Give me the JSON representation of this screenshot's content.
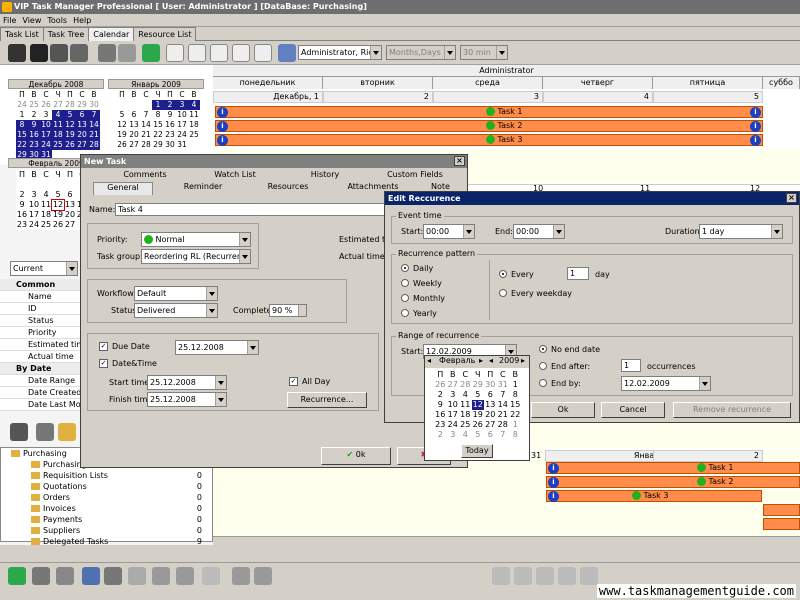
{
  "window": {
    "title": "VIP Task Manager Professional [ User: Administrator ] [DataBase: Purchasing]"
  },
  "menu": [
    "File",
    "View",
    "Tools",
    "Help"
  ],
  "view_tabs": [
    "Task List",
    "Task Tree",
    "Calendar",
    "Resource List"
  ],
  "toolbar": {
    "resource_combo": "Administrator, Rich M",
    "period_combo": "Months,Days",
    "interval_combo": "30 min"
  },
  "mini_calendar": {
    "month1": "Декабрь 2008",
    "month2": "Январь 2009",
    "month3": "Февраль 2009",
    "weekdays": [
      "П",
      "В",
      "С",
      "Ч",
      "П",
      "С",
      "В"
    ],
    "dec_days": [
      "24",
      "25",
      "26",
      "27",
      "28",
      "29",
      "30",
      "1",
      "2",
      "3",
      "4",
      "5",
      "6",
      "7",
      "8",
      "9",
      "10",
      "11",
      "12",
      "13",
      "14",
      "15",
      "16",
      "17",
      "18",
      "19",
      "20",
      "21",
      "22",
      "23",
      "24",
      "25",
      "26",
      "27",
      "28",
      "29",
      "30",
      "31"
    ],
    "jan_days": [
      "",
      "",
      "",
      "1",
      "2",
      "3",
      "4",
      "5",
      "6",
      "7",
      "8",
      "9",
      "10",
      "11",
      "12",
      "13",
      "14",
      "15",
      "16",
      "17",
      "18",
      "19",
      "20",
      "21",
      "22",
      "23",
      "24",
      "25",
      "26",
      "27",
      "28",
      "29",
      "30",
      "31"
    ],
    "feb_days": [
      "",
      "",
      "",
      "",
      "",
      "",
      "1",
      "2",
      "3",
      "4",
      "5",
      "6",
      "7",
      "8",
      "9",
      "10",
      "11",
      "12",
      "13",
      "14",
      "15",
      "16",
      "17",
      "18",
      "19",
      "20",
      "21",
      "22",
      "23",
      "24",
      "25",
      "26",
      "27"
    ]
  },
  "filter_combo": "Current",
  "properties": {
    "common_header": "Common",
    "common": [
      "Name",
      "ID",
      "Status",
      "Priority",
      "Estimated time",
      "Actual time"
    ],
    "bydate_header": "By Date",
    "bydate": [
      "Date Range",
      "Date Created",
      "Date Last Mod"
    ]
  },
  "tree": [
    {
      "label": "Purchasing",
      "count": ""
    },
    {
      "label": "Purchasing",
      "count": "0"
    },
    {
      "label": "Requisition Lists",
      "count": "0"
    },
    {
      "label": "Quotations",
      "count": "0"
    },
    {
      "label": "Orders",
      "count": "0"
    },
    {
      "label": "Invoices",
      "count": "0"
    },
    {
      "label": "Payments",
      "count": "0"
    },
    {
      "label": "Suppliers",
      "count": "0"
    },
    {
      "label": "Delegated Tasks",
      "count": "9"
    }
  ],
  "scheduler": {
    "resource": "Administrator",
    "days": [
      "понедельник",
      "вторник",
      "среда",
      "четверг",
      "пятница",
      "суббо"
    ],
    "week1_dates": [
      "Декабрь, 1",
      "2",
      "3",
      "4",
      "5"
    ],
    "week2_dates": [
      "10",
      "11",
      "12"
    ],
    "week3_dates": [
      "31",
      "Январь, 1",
      "2"
    ],
    "tasks_top": [
      "Task 1",
      "Task 2",
      "Task 3"
    ],
    "tasks_bottom": [
      "Task 1",
      "Task 2",
      "Task 3"
    ]
  },
  "new_task": {
    "title": "New Task",
    "tabs_row1": [
      "Comments",
      "Watch List",
      "History",
      "Custom Fields"
    ],
    "tabs_row2": [
      "General",
      "Reminder",
      "Resources",
      "Attachments",
      "Note"
    ],
    "name_label": "Name:",
    "name_value": "Task 4",
    "priority_label": "Priority:",
    "priority_value": "Normal",
    "group_label": "Task group:",
    "group_value": "Reordering RL (Recurrent tas",
    "est_label": "Estimated time",
    "act_label": "Actual time:",
    "workflow_label": "Workflow:",
    "workflow_value": "Default",
    "status_label": "Status:",
    "status_value": "Delivered",
    "complete_label": "Complete:",
    "complete_value": "90 %",
    "duedate_label": "Due Date",
    "duedate_value": "25.12.2008",
    "datetime_label": "Date&Time",
    "start_label": "Start time:",
    "start_value": "25.12.2008",
    "finish_label": "Finish time:",
    "finish_value": "25.12.2008",
    "allday_label": "All Day",
    "recurrence_button": "Recurrence...",
    "ok_button": "0k"
  },
  "recurrence": {
    "title": "Edit Reccurence",
    "event_time": "Event time",
    "start_label": "Start:",
    "start_value": "00:00",
    "end_label": "End:",
    "end_value": "00:00",
    "duration_label": "Duration:",
    "duration_value": "1 day",
    "pattern": "Recurrence pattern",
    "options": [
      "Daily",
      "Weekly",
      "Monthly",
      "Yearly"
    ],
    "every_label": "Every",
    "every_value": "1",
    "day_label": "day",
    "every_weekday": "Every weekday",
    "range": "Range of recurrence",
    "range_start_label": "Start:",
    "range_start_value": "12.02.2009",
    "no_end": "No end date",
    "end_after": "End after:",
    "occ_value": "1",
    "occurrences": "occurrences",
    "end_by": "End by:",
    "end_by_value": "12.02.2009",
    "ok": "Ok",
    "cancel": "Cancel",
    "remove": "Remove recurrence",
    "dropdown": {
      "month": "Февраль",
      "year": "2009",
      "days": [
        "26",
        "27",
        "28",
        "29",
        "30",
        "31",
        "1",
        "2",
        "3",
        "4",
        "5",
        "6",
        "7",
        "8",
        "9",
        "10",
        "11",
        "12",
        "13",
        "14",
        "15",
        "16",
        "17",
        "18",
        "19",
        "20",
        "21",
        "22",
        "23",
        "24",
        "25",
        "26",
        "27",
        "28",
        "1",
        "2",
        "3",
        "4",
        "5",
        "6",
        "7",
        "8"
      ],
      "today": "Today"
    }
  },
  "watermark": "www.taskmanagementguide.com"
}
